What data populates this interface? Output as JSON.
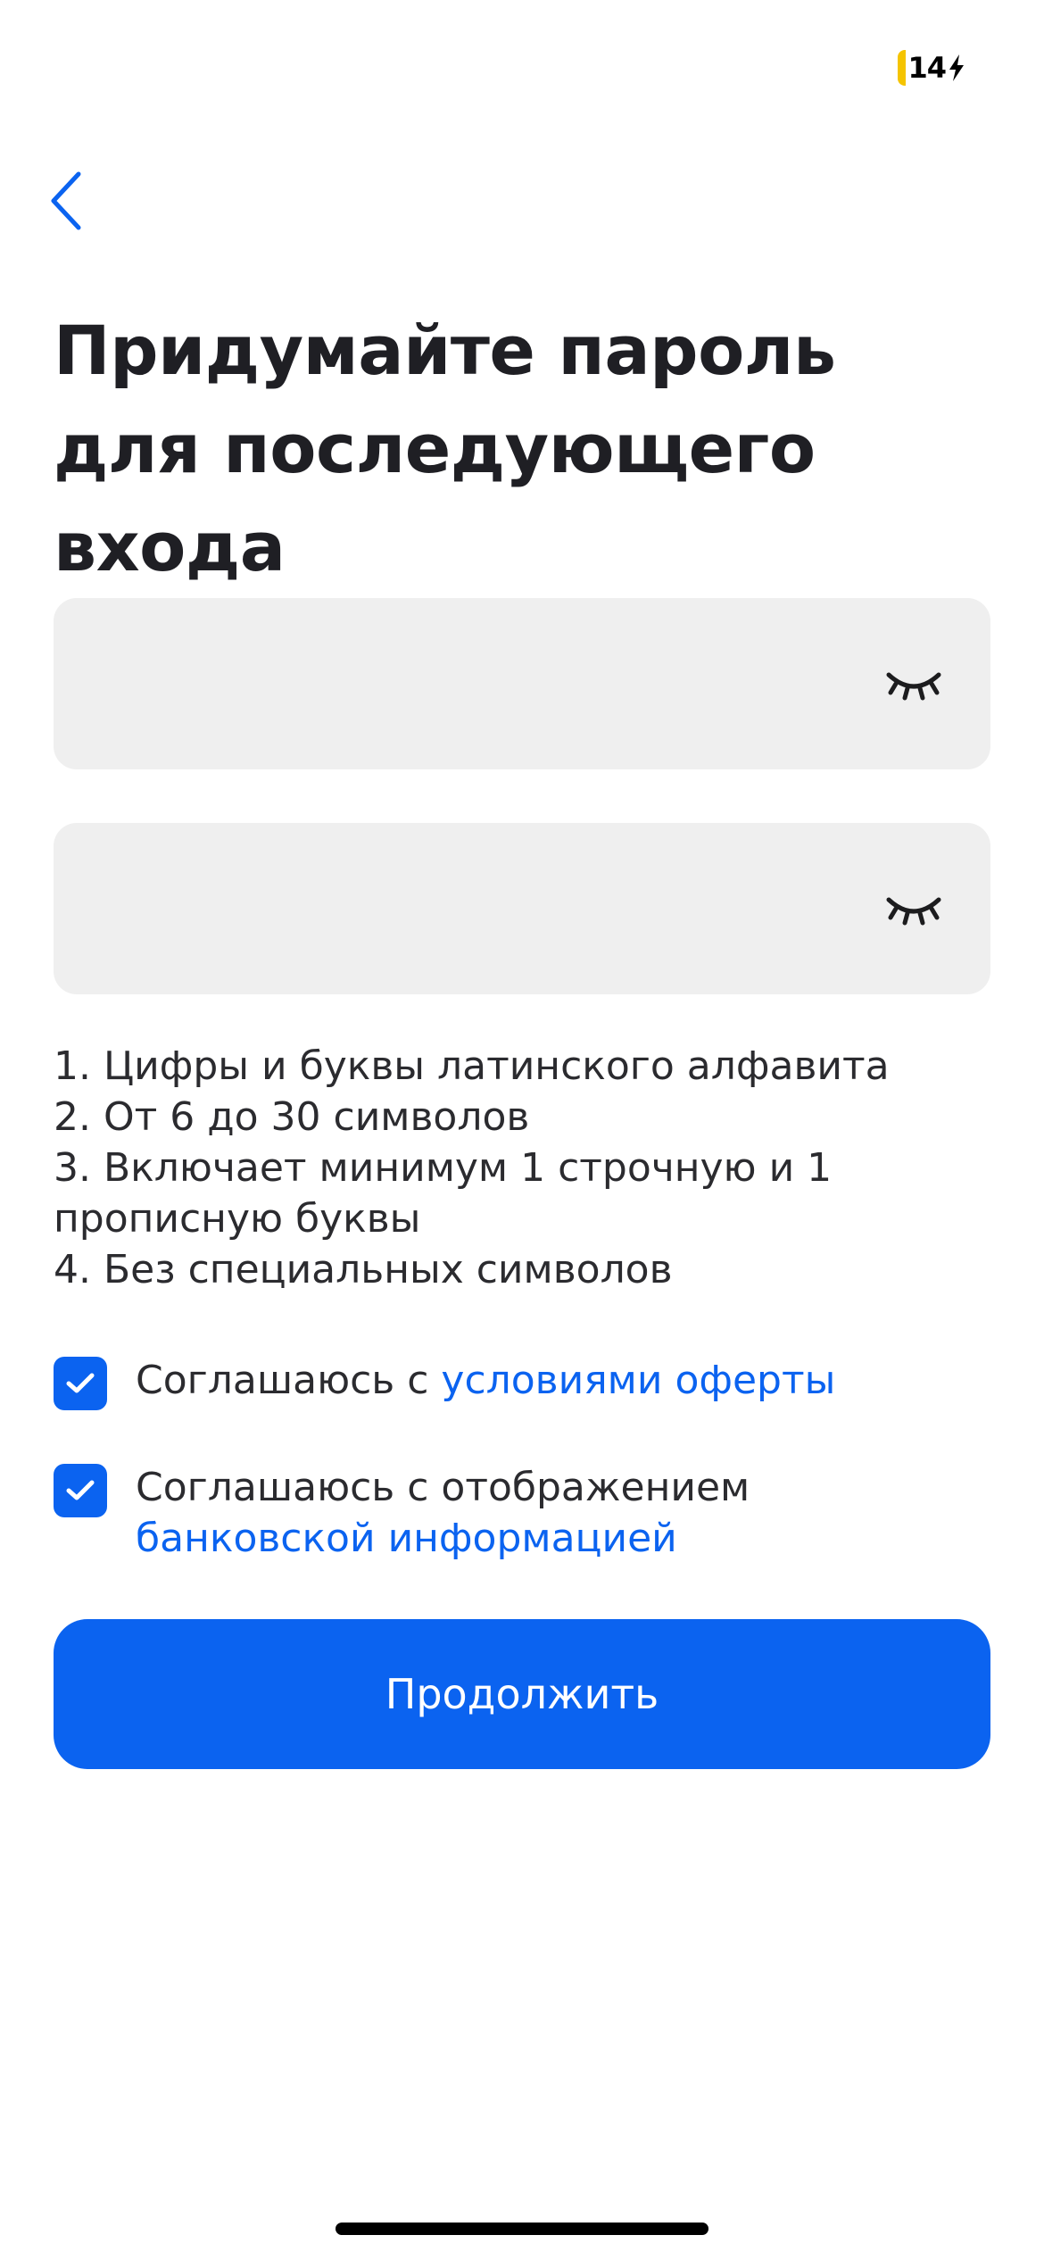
{
  "status_bar": {
    "battery_level": "14",
    "battery_color": "#f5c400",
    "charging_icon": "bolt-icon"
  },
  "header": {
    "back_icon": "chevron-left-icon",
    "title": "Придумайте пароль для последующего входа"
  },
  "form": {
    "password": {
      "value": "",
      "visibility_icon": "eye-closed-icon"
    },
    "password_confirm": {
      "value": "",
      "visibility_icon": "eye-closed-icon"
    }
  },
  "requirements": [
    "1. Цифры и буквы латинского алфавита",
    "2. От 6 до 30 символов",
    "3. Включает минимум 1 строчную и 1 прописную буквы",
    "4. Без специальных символов"
  ],
  "consents": [
    {
      "checked": true,
      "text": "Соглашаюсь с ",
      "link": "условиями оферты"
    },
    {
      "checked": true,
      "text": "Соглашаюсь с отображением ",
      "link": "банковской информацией"
    }
  ],
  "continue_label": "Продолжить",
  "colors": {
    "accent": "#0b63f0",
    "field_background": "#efefef",
    "title_text": "#1f1f24"
  }
}
